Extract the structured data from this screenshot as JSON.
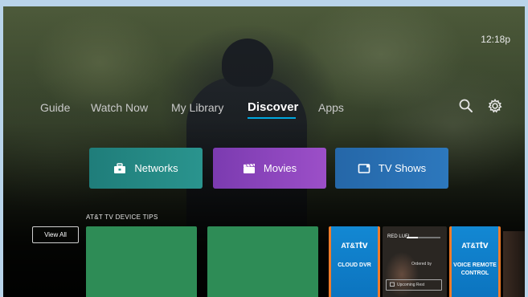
{
  "clock": "12:18p",
  "nav": {
    "items": [
      {
        "label": "Guide",
        "active": false
      },
      {
        "label": "Watch Now",
        "active": false
      },
      {
        "label": "My Library",
        "active": false
      },
      {
        "label": "Discover",
        "active": true
      },
      {
        "label": "Apps",
        "active": false
      }
    ],
    "icons": [
      "search-icon",
      "gear-icon"
    ]
  },
  "categories": [
    {
      "label": "Networks",
      "icon": "briefcase-tv-icon",
      "color": "#2a948e"
    },
    {
      "label": "Movies",
      "icon": "clapperboard-icon",
      "color": "#9c4fc8"
    },
    {
      "label": "TV Shows",
      "icon": "tv-screen-icon",
      "color": "#2d78bd"
    }
  ],
  "tips": {
    "section_title": "AT&T TV DEVICE TIPS",
    "view_all": "View All",
    "tiles": [
      {
        "kind": "blank",
        "color": "#2e8c56"
      },
      {
        "kind": "blank",
        "color": "#2e8c56"
      },
      {
        "kind": "brand",
        "brand": "AT&T",
        "brand_tv": "tv",
        "label": "CLOUD DVR"
      },
      {
        "kind": "preview",
        "title": "RED LUFI",
        "ordered": "Ordered by",
        "upcoming": "Upcoming Rest"
      },
      {
        "kind": "brand",
        "brand": "AT&T",
        "brand_tv": "tv",
        "label": "VOICE REMOTE CONTROL"
      }
    ]
  },
  "accent": "#00a8e0",
  "tile_border": "#f07c2a"
}
